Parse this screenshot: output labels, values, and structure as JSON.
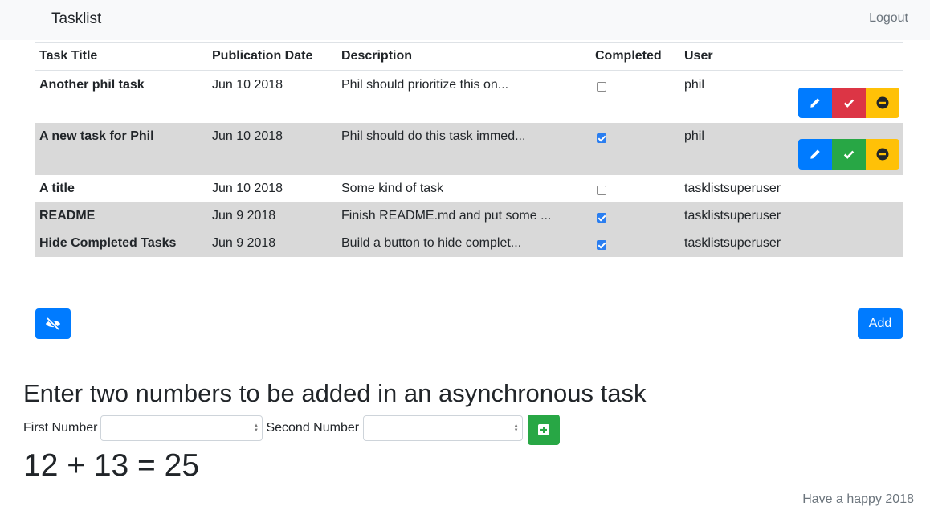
{
  "navbar": {
    "brand": "Tasklist",
    "logout": "Logout"
  },
  "table": {
    "headers": [
      "Task Title",
      "Publication Date",
      "Description",
      "Completed",
      "User"
    ],
    "rows": [
      {
        "title": "Another phil task",
        "date": "Jun 10 2018",
        "description": "Phil should prioritize this on...",
        "completed": false,
        "user": "phil",
        "actions": [
          "edit",
          "complete",
          "remove"
        ]
      },
      {
        "title": "A new task for Phil",
        "date": "Jun 10 2018",
        "description": "Phil should do this task immed...",
        "completed": true,
        "user": "phil",
        "actions": [
          "edit",
          "complete",
          "remove"
        ]
      },
      {
        "title": "A title",
        "date": "Jun 10 2018",
        "description": "Some kind of task",
        "completed": false,
        "user": "tasklistsuperuser"
      },
      {
        "title": "README",
        "date": "Jun 9 2018",
        "description": "Finish README.md and put some ...",
        "completed": true,
        "user": "tasklistsuperuser"
      },
      {
        "title": "Hide Completed Tasks",
        "date": "Jun 9 2018",
        "description": "Build a button to hide complet...",
        "completed": true,
        "user": "tasklistsuperuser"
      }
    ]
  },
  "buttons": {
    "add": "Add",
    "hide_icon": "eye-slash-icon"
  },
  "async_form": {
    "heading": "Enter two numbers to be added in an asynchronous task",
    "first_label": "First Number",
    "second_label": "Second Number",
    "first_value": "",
    "second_value": "",
    "result": "12 + 13 = 25"
  },
  "footer": "Have a happy 2018",
  "colors": {
    "primary": "#007bff",
    "danger": "#dc3545",
    "success": "#28a745",
    "warning": "#ffc107",
    "row_shade": "#d9d9d9"
  }
}
